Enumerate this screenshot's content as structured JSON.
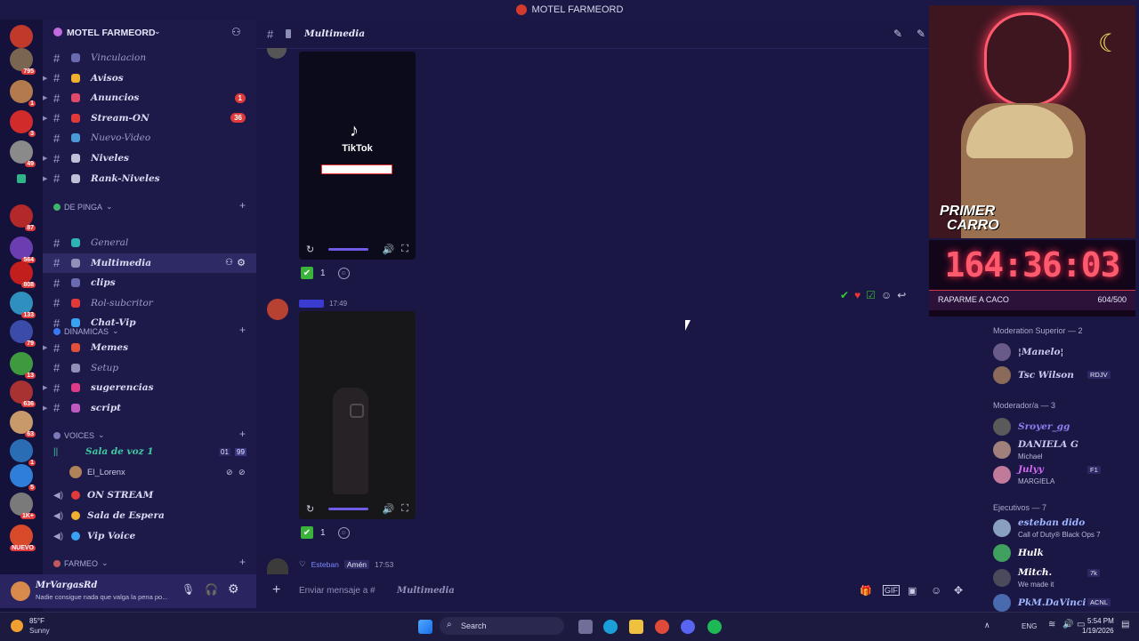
{
  "window": {
    "title": "MOTEL FARMEORD"
  },
  "server": {
    "name": "MOTEL FARMEORD"
  },
  "rail_badges": [
    "795",
    "1",
    "3",
    "49",
    "4",
    "87",
    "564",
    "808",
    "133",
    "79",
    "13",
    "636",
    "63",
    "1",
    "5",
    "1K+",
    "NUEVO"
  ],
  "channels_top": [
    {
      "name": "Vinculacion",
      "muted": true
    },
    {
      "name": "Avisos"
    },
    {
      "name": "Anuncios",
      "badge": "1"
    },
    {
      "name": "Stream-ON",
      "badge": "36"
    },
    {
      "name": "Nuevo-Video",
      "muted": true
    },
    {
      "name": "Niveles"
    },
    {
      "name": "Rank-Niveles"
    }
  ],
  "categories": {
    "pinga": "DE PINGA",
    "dinamicas": "DINAMICAS",
    "voices": "VOICES",
    "farmeo": "FARMEO"
  },
  "channels_pinga": [
    {
      "name": "General",
      "muted": true
    },
    {
      "name": "Multimedia",
      "active": true
    },
    {
      "name": "clips"
    },
    {
      "name": "Rol-subcritor",
      "muted": true
    },
    {
      "name": "Chat-Vip"
    }
  ],
  "channels_dinamicas": [
    {
      "name": "Memes"
    },
    {
      "name": "Setup",
      "muted": true
    },
    {
      "name": "sugerencias"
    },
    {
      "name": "script"
    }
  ],
  "voice": {
    "room": "Sala de voz 1",
    "count_a": "01",
    "count_b": "99",
    "user": "El_Lorenx",
    "others": [
      "ON STREAM",
      "Sala de Espera",
      "Vip Voice"
    ]
  },
  "user_panel": {
    "name": "MrVargasRd",
    "status": "Nadie consigue nada que valga la pena po..."
  },
  "channel_header": {
    "name": "Multimedia"
  },
  "message": {
    "time": "17:49",
    "reaction_count_1": "1",
    "reaction_count_2": "1",
    "tiktok_label": "TikTok",
    "last_author": "Esteban",
    "last_role": "Amén",
    "last_time": "17:53"
  },
  "composer": {
    "placeholder": "Enviar mensaje a #",
    "channel": "Multimedia"
  },
  "stream": {
    "overlay_text_1": "PRIMER",
    "overlay_text_2": "CARRO",
    "timer": "164:36:03",
    "goal_label": "RAPARME A CACO",
    "goal_count": "604/500"
  },
  "members": {
    "cat1": "Moderation Superior — 2",
    "cat2": "Moderador/a — 3",
    "cat3": "Ejecutivos — 7",
    "list1": [
      {
        "name": "¦Manelo¦",
        "color": "#c9c6f2"
      },
      {
        "name": "Tsc Wilson",
        "color": "#c9c6f2",
        "tag": "RDJV"
      }
    ],
    "list2": [
      {
        "name": "Sroyer_gg",
        "color": "#8d7ef0"
      },
      {
        "name": "DANIELA G",
        "color": "#c9c6f2",
        "status": "Michael"
      },
      {
        "name": "Julyy",
        "color": "#d36af0",
        "status": "MARGIELA",
        "tag": "F1"
      }
    ],
    "list3": [
      {
        "name": "esteban dido",
        "color": "#9fb6ff",
        "status": "Call of Duty® Black Ops 7"
      },
      {
        "name": "Hulk",
        "color": "#ffffff"
      },
      {
        "name": "Mitch.",
        "color": "#ffffff",
        "status": "We made it",
        "tag": "7k"
      },
      {
        "name": "PkM.DaVinci",
        "color": "#9fb6ff",
        "tag": "ACNL"
      }
    ]
  },
  "taskbar": {
    "weather_temp": "85°F",
    "weather_desc": "Sunny",
    "search": "Search",
    "lang": "ENG",
    "time": "5:54 PM",
    "date": "1/19/2026"
  }
}
